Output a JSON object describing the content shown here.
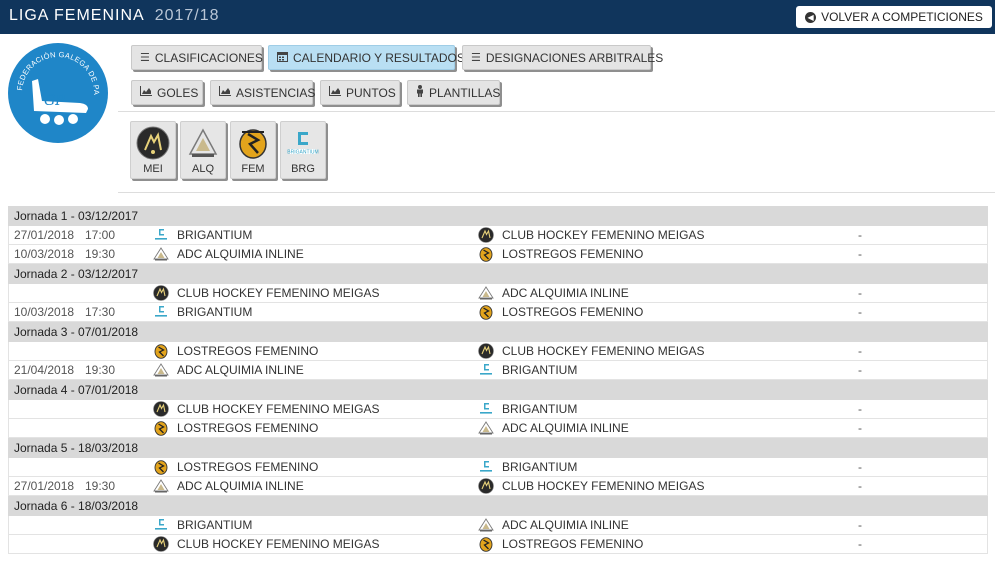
{
  "header": {
    "league": "LIGA FEMENINA",
    "season": "2017/18",
    "back_label": "VOLVER A COMPETICIONES",
    "logo_text": "FEDERACIÓN GALEGA DE PATINAXE",
    "logo_monogram": "GP"
  },
  "tabs_row1": [
    {
      "label": "CLASIFICACIONES",
      "icon": "list-icon",
      "active": false
    },
    {
      "label": "CALENDARIO Y RESULTADOS",
      "icon": "calendar-icon",
      "active": true
    },
    {
      "label": "DESIGNACIONES ARBITRALES",
      "icon": "list-icon",
      "active": false
    }
  ],
  "tabs_row2": [
    {
      "label": "GOLES",
      "icon": "area-chart-icon"
    },
    {
      "label": "ASISTENCIAS",
      "icon": "area-chart-icon"
    },
    {
      "label": "PUNTOS",
      "icon": "area-chart-icon"
    },
    {
      "label": "PLANTILLAS",
      "icon": "person-icon"
    }
  ],
  "teams": [
    {
      "code": "MEI",
      "emblem": "meigas"
    },
    {
      "code": "ALQ",
      "emblem": "alquimia"
    },
    {
      "code": "FEM",
      "emblem": "lostregos"
    },
    {
      "code": "BRG",
      "emblem": "brigantium"
    }
  ],
  "jornadas": [
    {
      "title": "Jornada 1 - 03/12/2017",
      "matches": [
        {
          "date": "27/01/2018",
          "time": "17:00",
          "home": "BRIGANTIUM",
          "home_emblem": "brigantium",
          "away": "CLUB HOCKEY FEMENINO MEIGAS",
          "away_emblem": "meigas",
          "result": "-"
        },
        {
          "date": "10/03/2018",
          "time": "19:30",
          "home": "ADC ALQUIMIA INLINE",
          "home_emblem": "alquimia",
          "away": "LOSTREGOS FEMENINO",
          "away_emblem": "lostregos",
          "result": "-"
        }
      ]
    },
    {
      "title": "Jornada 2 - 03/12/2017",
      "matches": [
        {
          "date": "",
          "time": "",
          "home": "CLUB HOCKEY FEMENINO MEIGAS",
          "home_emblem": "meigas",
          "away": "ADC ALQUIMIA INLINE",
          "away_emblem": "alquimia",
          "result": "-"
        },
        {
          "date": "10/03/2018",
          "time": "17:30",
          "home": "BRIGANTIUM",
          "home_emblem": "brigantium",
          "away": "LOSTREGOS FEMENINO",
          "away_emblem": "lostregos",
          "result": "-"
        }
      ]
    },
    {
      "title": "Jornada 3 - 07/01/2018",
      "matches": [
        {
          "date": "",
          "time": "",
          "home": "LOSTREGOS FEMENINO",
          "home_emblem": "lostregos",
          "away": "CLUB HOCKEY FEMENINO MEIGAS",
          "away_emblem": "meigas",
          "result": "-"
        },
        {
          "date": "21/04/2018",
          "time": "19:30",
          "home": "ADC ALQUIMIA INLINE",
          "home_emblem": "alquimia",
          "away": "BRIGANTIUM",
          "away_emblem": "brigantium",
          "result": "-"
        }
      ]
    },
    {
      "title": "Jornada 4 - 07/01/2018",
      "matches": [
        {
          "date": "",
          "time": "",
          "home": "CLUB HOCKEY FEMENINO MEIGAS",
          "home_emblem": "meigas",
          "away": "BRIGANTIUM",
          "away_emblem": "brigantium",
          "result": "-"
        },
        {
          "date": "",
          "time": "",
          "home": "LOSTREGOS FEMENINO",
          "home_emblem": "lostregos",
          "away": "ADC ALQUIMIA INLINE",
          "away_emblem": "alquimia",
          "result": "-"
        }
      ]
    },
    {
      "title": "Jornada 5 - 18/03/2018",
      "matches": [
        {
          "date": "",
          "time": "",
          "home": "LOSTREGOS FEMENINO",
          "home_emblem": "lostregos",
          "away": "BRIGANTIUM",
          "away_emblem": "brigantium",
          "result": "-"
        },
        {
          "date": "27/01/2018",
          "time": "19:30",
          "home": "ADC ALQUIMIA INLINE",
          "home_emblem": "alquimia",
          "away": "CLUB HOCKEY FEMENINO MEIGAS",
          "away_emblem": "meigas",
          "result": "-"
        }
      ]
    },
    {
      "title": "Jornada 6 - 18/03/2018",
      "matches": [
        {
          "date": "",
          "time": "",
          "home": "BRIGANTIUM",
          "home_emblem": "brigantium",
          "away": "ADC ALQUIMIA INLINE",
          "away_emblem": "alquimia",
          "result": "-"
        },
        {
          "date": "",
          "time": "",
          "home": "CLUB HOCKEY FEMENINO MEIGAS",
          "home_emblem": "meigas",
          "away": "LOSTREGOS FEMENINO",
          "away_emblem": "lostregos",
          "result": "-"
        }
      ]
    }
  ],
  "colors": {
    "topbar": "#10355c",
    "active_tab": "#b9dff3",
    "jornada_header": "#d9d9d9",
    "logo_blue": "#1f86c8"
  }
}
